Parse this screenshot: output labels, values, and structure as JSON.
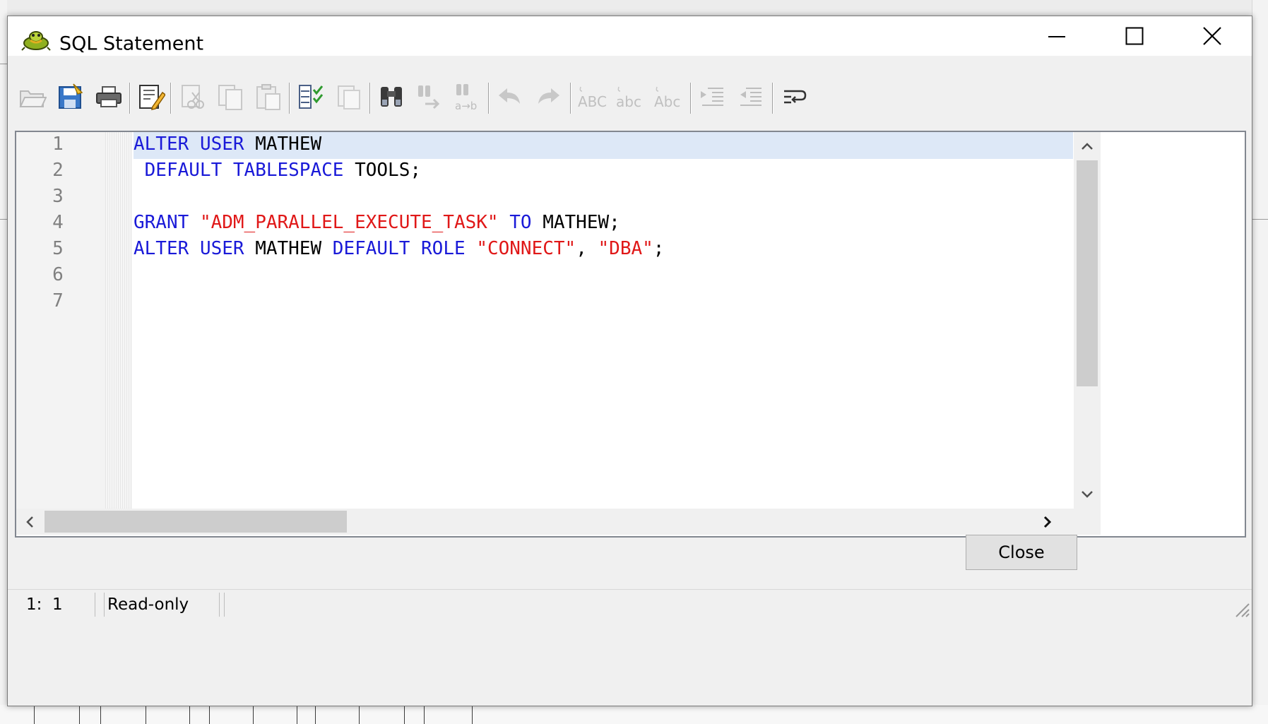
{
  "window": {
    "title": "SQL Statement",
    "icon": "toad-icon",
    "controls": [
      "minimize-icon",
      "maximize-icon",
      "close-icon"
    ]
  },
  "toolbar": {
    "buttons": [
      {
        "icon": "open-folder-icon",
        "enabled": false
      },
      {
        "icon": "save-icon",
        "enabled": true
      },
      {
        "icon": "print-icon",
        "enabled": true
      },
      {
        "icon": "edit-icon",
        "enabled": true
      },
      {
        "icon": "cut-icon",
        "enabled": false
      },
      {
        "icon": "copy-icon",
        "enabled": false
      },
      {
        "icon": "paste-icon",
        "enabled": false
      },
      {
        "icon": "select-all-icon",
        "enabled": true
      },
      {
        "icon": "clear-icon",
        "enabled": false
      },
      {
        "icon": "find-icon",
        "enabled": true
      },
      {
        "icon": "find-next-icon",
        "enabled": false
      },
      {
        "icon": "replace-icon",
        "enabled": false
      },
      {
        "icon": "undo-icon",
        "enabled": false
      },
      {
        "icon": "redo-icon",
        "enabled": false
      },
      {
        "icon": "uppercase-icon",
        "enabled": false
      },
      {
        "icon": "lowercase-icon",
        "enabled": false
      },
      {
        "icon": "capitalize-icon",
        "enabled": false
      },
      {
        "icon": "indent-icon",
        "enabled": false
      },
      {
        "icon": "outdent-icon",
        "enabled": false
      },
      {
        "icon": "word-wrap-icon",
        "enabled": true
      }
    ],
    "glyphs": {
      "upper": "ABC",
      "lower": "abc",
      "cap": "Abc",
      "ab": "a→b"
    }
  },
  "editor": {
    "line_numbers": [
      "1",
      "2",
      "3",
      "4",
      "5",
      "6",
      "7"
    ],
    "lines": [
      [
        {
          "t": "kw",
          "v": "ALTER"
        },
        {
          "t": "id",
          "v": " "
        },
        {
          "t": "kw",
          "v": "USER"
        },
        {
          "t": "id",
          "v": " MATHEW"
        }
      ],
      [
        {
          "t": "id",
          "v": " "
        },
        {
          "t": "kw",
          "v": "DEFAULT"
        },
        {
          "t": "id",
          "v": " "
        },
        {
          "t": "kw",
          "v": "TABLESPACE"
        },
        {
          "t": "id",
          "v": " TOOLS;"
        }
      ],
      [],
      [
        {
          "t": "kw",
          "v": "GRANT"
        },
        {
          "t": "id",
          "v": " "
        },
        {
          "t": "str",
          "v": "\"ADM_PARALLEL_EXECUTE_TASK\""
        },
        {
          "t": "id",
          "v": " "
        },
        {
          "t": "kw",
          "v": "TO"
        },
        {
          "t": "id",
          "v": " MATHEW;"
        }
      ],
      [
        {
          "t": "kw",
          "v": "ALTER"
        },
        {
          "t": "id",
          "v": " "
        },
        {
          "t": "kw",
          "v": "USER"
        },
        {
          "t": "id",
          "v": " MATHEW "
        },
        {
          "t": "kw",
          "v": "DEFAULT"
        },
        {
          "t": "id",
          "v": " "
        },
        {
          "t": "kw",
          "v": "ROLE"
        },
        {
          "t": "id",
          "v": " "
        },
        {
          "t": "str",
          "v": "\"CONNECT\""
        },
        {
          "t": "id",
          "v": ", "
        },
        {
          "t": "str",
          "v": "\"DBA\""
        },
        {
          "t": "id",
          "v": ";"
        }
      ],
      [],
      []
    ],
    "current_line": 1
  },
  "buttons": {
    "close_label": "Close"
  },
  "status": {
    "position": "1:  1",
    "mode": "Read-only"
  },
  "colors": {
    "keyword": "#1a1ad8",
    "string": "#e01818",
    "current_line": "#dde8f7"
  }
}
